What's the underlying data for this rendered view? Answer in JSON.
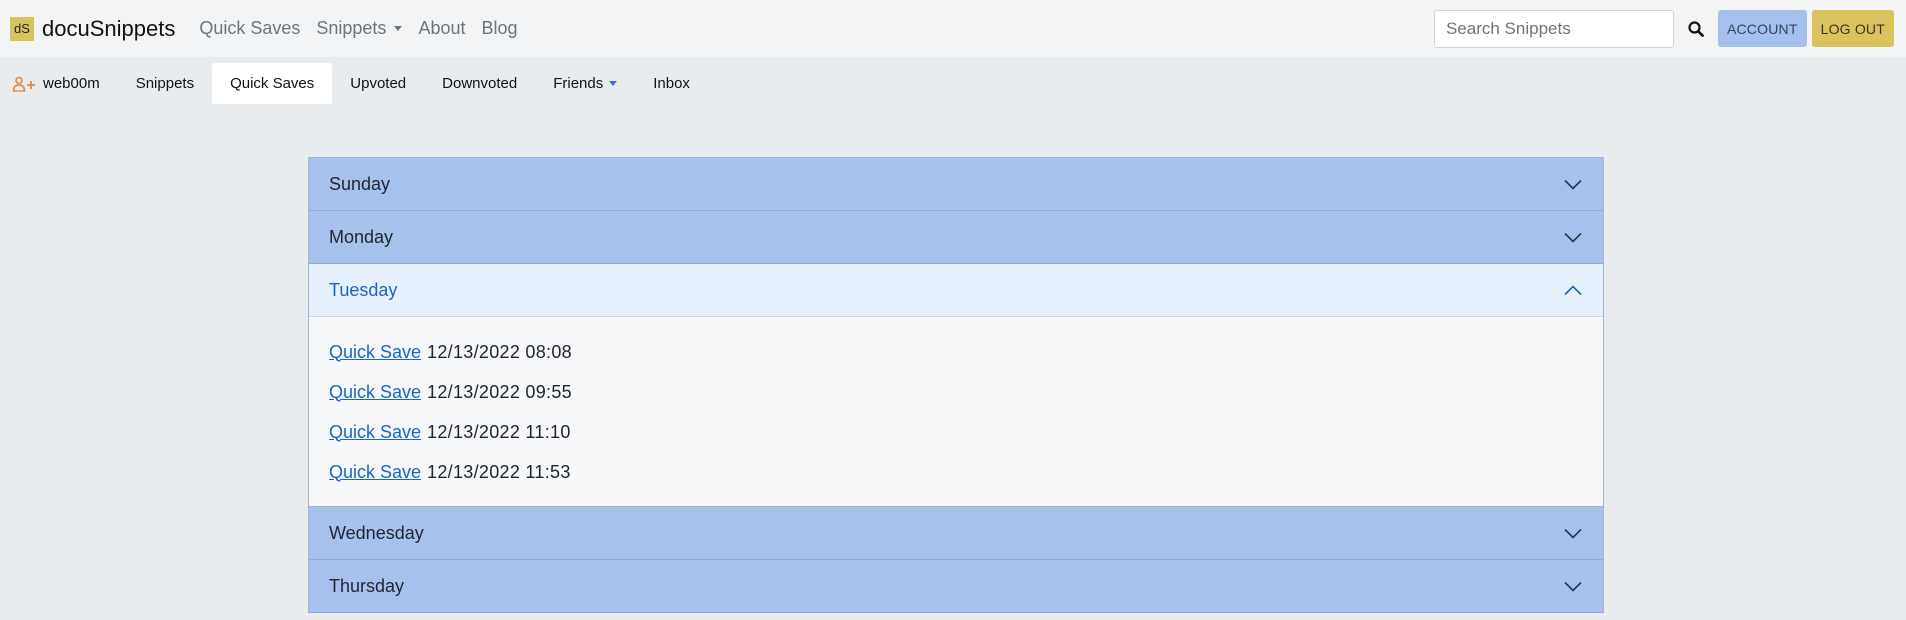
{
  "brand": {
    "logo_text": "dS",
    "name": "docuSnippets"
  },
  "nav": {
    "links": [
      {
        "label": "Quick Saves"
      },
      {
        "label": "Snippets",
        "dropdown": true
      },
      {
        "label": "About"
      },
      {
        "label": "Blog"
      }
    ]
  },
  "search": {
    "placeholder": "Search Snippets",
    "value": ""
  },
  "buttons": {
    "account": "ACCOUNT",
    "logout": "LOG OUT"
  },
  "subnav": {
    "user": "web00m",
    "tabs": [
      {
        "label": "Snippets",
        "active": false
      },
      {
        "label": "Quick Saves",
        "active": true
      },
      {
        "label": "Upvoted",
        "active": false
      },
      {
        "label": "Downvoted",
        "active": false
      },
      {
        "label": "Friends",
        "active": false
      },
      {
        "label": "Inbox",
        "active": false
      }
    ]
  },
  "days": [
    {
      "label": "Sunday",
      "open": false
    },
    {
      "label": "Monday",
      "open": false
    },
    {
      "label": "Tuesday",
      "open": true,
      "items": [
        {
          "link": "Quick Save",
          "date": "12/13/2022 08:08"
        },
        {
          "link": "Quick Save",
          "date": "12/13/2022 09:55"
        },
        {
          "link": "Quick Save",
          "date": "12/13/2022 11:10"
        },
        {
          "link": "Quick Save",
          "date": "12/13/2022 11:53"
        }
      ]
    },
    {
      "label": "Wednesday",
      "open": false
    },
    {
      "label": "Thursday",
      "open": false
    }
  ],
  "colors": {
    "accordion_collapsed": "#a8c0ed",
    "accordion_open": "#e7f0fd",
    "link": "#1a64c8",
    "account_button": "#a7bfed",
    "logout_button": "#d9c35f"
  }
}
